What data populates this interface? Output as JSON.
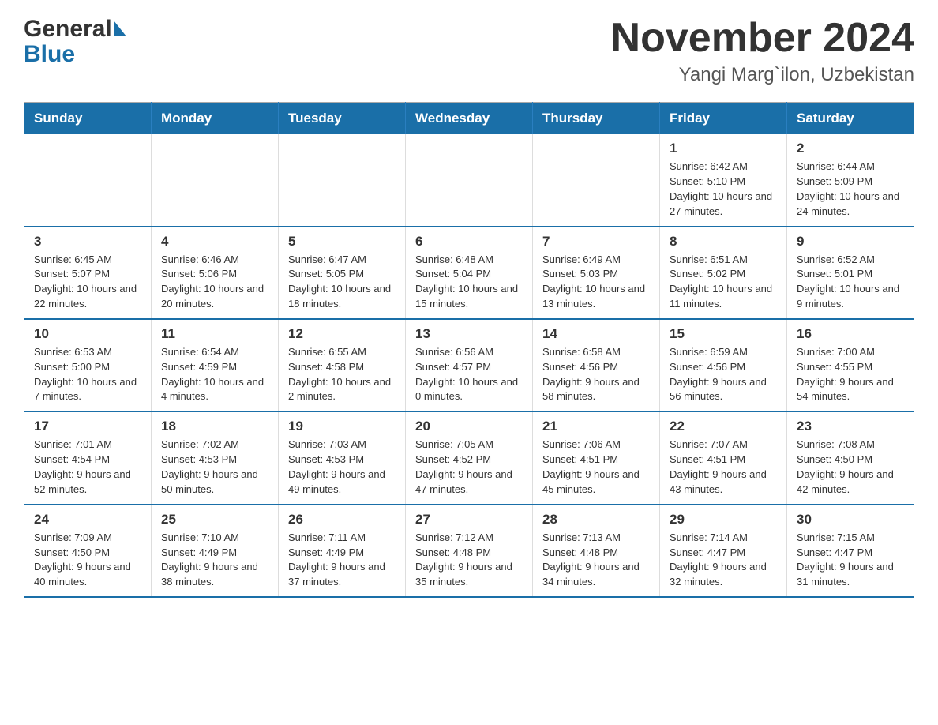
{
  "header": {
    "logo_general": "General",
    "logo_blue": "Blue",
    "month_year": "November 2024",
    "location": "Yangi Marg`ilon, Uzbekistan"
  },
  "days_of_week": [
    "Sunday",
    "Monday",
    "Tuesday",
    "Wednesday",
    "Thursday",
    "Friday",
    "Saturday"
  ],
  "weeks": [
    [
      {
        "day": "",
        "sunrise": "",
        "sunset": "",
        "daylight": ""
      },
      {
        "day": "",
        "sunrise": "",
        "sunset": "",
        "daylight": ""
      },
      {
        "day": "",
        "sunrise": "",
        "sunset": "",
        "daylight": ""
      },
      {
        "day": "",
        "sunrise": "",
        "sunset": "",
        "daylight": ""
      },
      {
        "day": "",
        "sunrise": "",
        "sunset": "",
        "daylight": ""
      },
      {
        "day": "1",
        "sunrise": "Sunrise: 6:42 AM",
        "sunset": "Sunset: 5:10 PM",
        "daylight": "Daylight: 10 hours and 27 minutes."
      },
      {
        "day": "2",
        "sunrise": "Sunrise: 6:44 AM",
        "sunset": "Sunset: 5:09 PM",
        "daylight": "Daylight: 10 hours and 24 minutes."
      }
    ],
    [
      {
        "day": "3",
        "sunrise": "Sunrise: 6:45 AM",
        "sunset": "Sunset: 5:07 PM",
        "daylight": "Daylight: 10 hours and 22 minutes."
      },
      {
        "day": "4",
        "sunrise": "Sunrise: 6:46 AM",
        "sunset": "Sunset: 5:06 PM",
        "daylight": "Daylight: 10 hours and 20 minutes."
      },
      {
        "day": "5",
        "sunrise": "Sunrise: 6:47 AM",
        "sunset": "Sunset: 5:05 PM",
        "daylight": "Daylight: 10 hours and 18 minutes."
      },
      {
        "day": "6",
        "sunrise": "Sunrise: 6:48 AM",
        "sunset": "Sunset: 5:04 PM",
        "daylight": "Daylight: 10 hours and 15 minutes."
      },
      {
        "day": "7",
        "sunrise": "Sunrise: 6:49 AM",
        "sunset": "Sunset: 5:03 PM",
        "daylight": "Daylight: 10 hours and 13 minutes."
      },
      {
        "day": "8",
        "sunrise": "Sunrise: 6:51 AM",
        "sunset": "Sunset: 5:02 PM",
        "daylight": "Daylight: 10 hours and 11 minutes."
      },
      {
        "day": "9",
        "sunrise": "Sunrise: 6:52 AM",
        "sunset": "Sunset: 5:01 PM",
        "daylight": "Daylight: 10 hours and 9 minutes."
      }
    ],
    [
      {
        "day": "10",
        "sunrise": "Sunrise: 6:53 AM",
        "sunset": "Sunset: 5:00 PM",
        "daylight": "Daylight: 10 hours and 7 minutes."
      },
      {
        "day": "11",
        "sunrise": "Sunrise: 6:54 AM",
        "sunset": "Sunset: 4:59 PM",
        "daylight": "Daylight: 10 hours and 4 minutes."
      },
      {
        "day": "12",
        "sunrise": "Sunrise: 6:55 AM",
        "sunset": "Sunset: 4:58 PM",
        "daylight": "Daylight: 10 hours and 2 minutes."
      },
      {
        "day": "13",
        "sunrise": "Sunrise: 6:56 AM",
        "sunset": "Sunset: 4:57 PM",
        "daylight": "Daylight: 10 hours and 0 minutes."
      },
      {
        "day": "14",
        "sunrise": "Sunrise: 6:58 AM",
        "sunset": "Sunset: 4:56 PM",
        "daylight": "Daylight: 9 hours and 58 minutes."
      },
      {
        "day": "15",
        "sunrise": "Sunrise: 6:59 AM",
        "sunset": "Sunset: 4:56 PM",
        "daylight": "Daylight: 9 hours and 56 minutes."
      },
      {
        "day": "16",
        "sunrise": "Sunrise: 7:00 AM",
        "sunset": "Sunset: 4:55 PM",
        "daylight": "Daylight: 9 hours and 54 minutes."
      }
    ],
    [
      {
        "day": "17",
        "sunrise": "Sunrise: 7:01 AM",
        "sunset": "Sunset: 4:54 PM",
        "daylight": "Daylight: 9 hours and 52 minutes."
      },
      {
        "day": "18",
        "sunrise": "Sunrise: 7:02 AM",
        "sunset": "Sunset: 4:53 PM",
        "daylight": "Daylight: 9 hours and 50 minutes."
      },
      {
        "day": "19",
        "sunrise": "Sunrise: 7:03 AM",
        "sunset": "Sunset: 4:53 PM",
        "daylight": "Daylight: 9 hours and 49 minutes."
      },
      {
        "day": "20",
        "sunrise": "Sunrise: 7:05 AM",
        "sunset": "Sunset: 4:52 PM",
        "daylight": "Daylight: 9 hours and 47 minutes."
      },
      {
        "day": "21",
        "sunrise": "Sunrise: 7:06 AM",
        "sunset": "Sunset: 4:51 PM",
        "daylight": "Daylight: 9 hours and 45 minutes."
      },
      {
        "day": "22",
        "sunrise": "Sunrise: 7:07 AM",
        "sunset": "Sunset: 4:51 PM",
        "daylight": "Daylight: 9 hours and 43 minutes."
      },
      {
        "day": "23",
        "sunrise": "Sunrise: 7:08 AM",
        "sunset": "Sunset: 4:50 PM",
        "daylight": "Daylight: 9 hours and 42 minutes."
      }
    ],
    [
      {
        "day": "24",
        "sunrise": "Sunrise: 7:09 AM",
        "sunset": "Sunset: 4:50 PM",
        "daylight": "Daylight: 9 hours and 40 minutes."
      },
      {
        "day": "25",
        "sunrise": "Sunrise: 7:10 AM",
        "sunset": "Sunset: 4:49 PM",
        "daylight": "Daylight: 9 hours and 38 minutes."
      },
      {
        "day": "26",
        "sunrise": "Sunrise: 7:11 AM",
        "sunset": "Sunset: 4:49 PM",
        "daylight": "Daylight: 9 hours and 37 minutes."
      },
      {
        "day": "27",
        "sunrise": "Sunrise: 7:12 AM",
        "sunset": "Sunset: 4:48 PM",
        "daylight": "Daylight: 9 hours and 35 minutes."
      },
      {
        "day": "28",
        "sunrise": "Sunrise: 7:13 AM",
        "sunset": "Sunset: 4:48 PM",
        "daylight": "Daylight: 9 hours and 34 minutes."
      },
      {
        "day": "29",
        "sunrise": "Sunrise: 7:14 AM",
        "sunset": "Sunset: 4:47 PM",
        "daylight": "Daylight: 9 hours and 32 minutes."
      },
      {
        "day": "30",
        "sunrise": "Sunrise: 7:15 AM",
        "sunset": "Sunset: 4:47 PM",
        "daylight": "Daylight: 9 hours and 31 minutes."
      }
    ]
  ]
}
